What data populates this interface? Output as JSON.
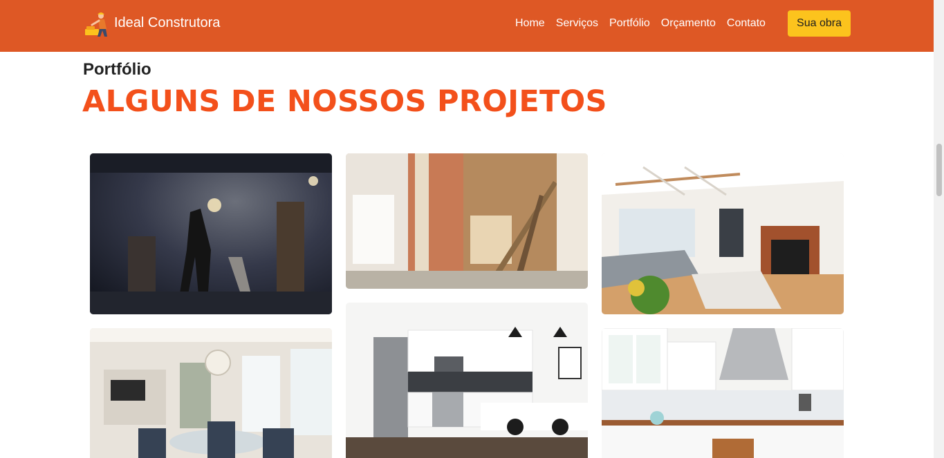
{
  "brand": {
    "name": "Ideal Construtora",
    "logo_icon": "worker-icon"
  },
  "nav": {
    "links": [
      "Home",
      "Serviços",
      "Portfólio",
      "Orçamento",
      "Contato"
    ],
    "cta_label": "Sua obra"
  },
  "section": {
    "eyebrow": "Portfólio",
    "title": "ALGUNS DE NOSSOS PROJETOS"
  },
  "colors": {
    "navbar": "#de5825",
    "cta": "#fcc31d",
    "title": "#f3501b"
  },
  "gallery": [
    {
      "id": "photo-worker-night"
    },
    {
      "id": "photo-demolition-wall"
    },
    {
      "id": "photo-living-room-fireplace"
    },
    {
      "id": "photo-dining-room"
    },
    {
      "id": "photo-white-kitchen"
    },
    {
      "id": "photo-kitchen-island"
    }
  ]
}
